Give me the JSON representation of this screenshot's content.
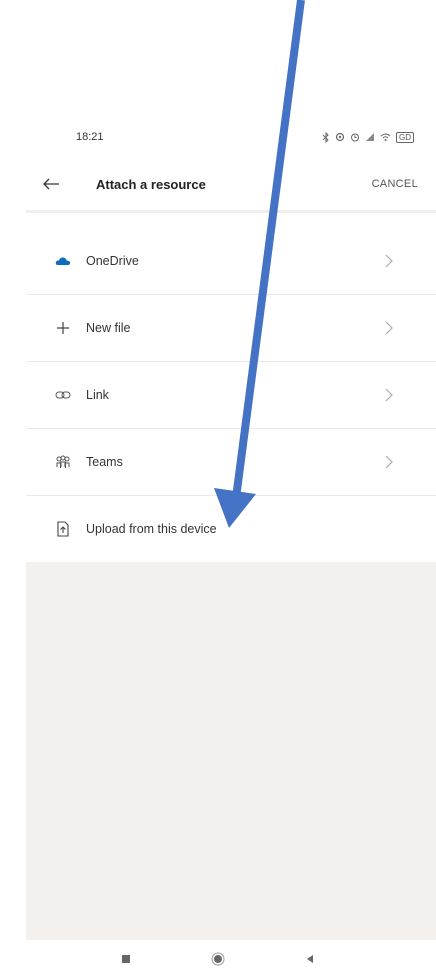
{
  "status_bar": {
    "time": "18:21",
    "battery_text": "GD"
  },
  "app_bar": {
    "title": "Attach a resource",
    "cancel_label": "CANCEL"
  },
  "list": {
    "items": [
      {
        "label": "OneDrive",
        "icon": "onedrive-cloud-icon",
        "has_chevron": true
      },
      {
        "label": "New file",
        "icon": "plus-icon",
        "has_chevron": true
      },
      {
        "label": "Link",
        "icon": "link-icon",
        "has_chevron": true
      },
      {
        "label": "Teams",
        "icon": "teams-icon",
        "has_chevron": true
      },
      {
        "label": "Upload from this device",
        "icon": "upload-device-icon",
        "has_chevron": false
      }
    ]
  },
  "nav_bar": {
    "buttons": [
      "recents-square-icon",
      "home-circle-icon",
      "back-triangle-icon"
    ]
  },
  "annotation": {
    "arrow_color": "#4472c4"
  }
}
